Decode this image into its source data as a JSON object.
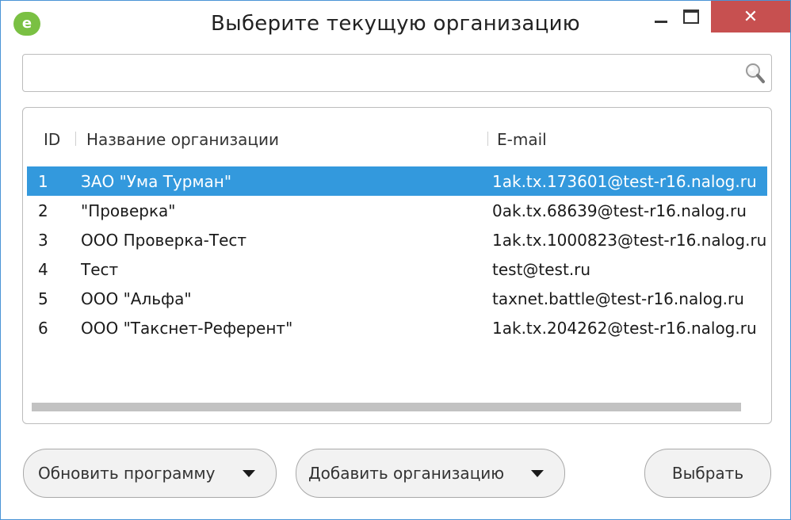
{
  "window": {
    "title": "Выберите текущую организацию",
    "app_icon_letter": "e",
    "close_glyph": "✕"
  },
  "search": {
    "value": "",
    "placeholder": ""
  },
  "table": {
    "columns": [
      "ID",
      "Название организации",
      "E-mail"
    ],
    "rows": [
      {
        "id": "1",
        "name": "ЗАО \"Ума Турман\"",
        "email": "1ak.tx.173601@test-r16.nalog.ru",
        "selected": true
      },
      {
        "id": "2",
        "name": "\"Проверка\"",
        "email": "0ak.tx.68639@test-r16.nalog.ru",
        "selected": false
      },
      {
        "id": "3",
        "name": "ООО Проверка-Тест",
        "email": "1ak.tx.1000823@test-r16.nalog.ru",
        "selected": false
      },
      {
        "id": "4",
        "name": "Тест",
        "email": "test@test.ru",
        "selected": false
      },
      {
        "id": "5",
        "name": "ООО \"Альфа\"",
        "email": "taxnet.battle@test-r16.nalog.ru",
        "selected": false
      },
      {
        "id": "6",
        "name": "ООО \"Такснет-Референт\"",
        "email": "1ak.tx.204262@test-r16.nalog.ru",
        "selected": false
      }
    ]
  },
  "buttons": {
    "update_label": "Обновить программу",
    "add_label": "Добавить организацию",
    "select_label": "Выбрать"
  },
  "colors": {
    "selection": "#3399dd",
    "close_button": "#c75050",
    "app_icon": "#7ac043"
  },
  "icons": {
    "app": "app-logo-icon",
    "search": "search-icon",
    "minimize": "minimize-icon",
    "maximize": "maximize-icon",
    "close": "close-icon",
    "dropdown": "chevron-down-icon"
  }
}
